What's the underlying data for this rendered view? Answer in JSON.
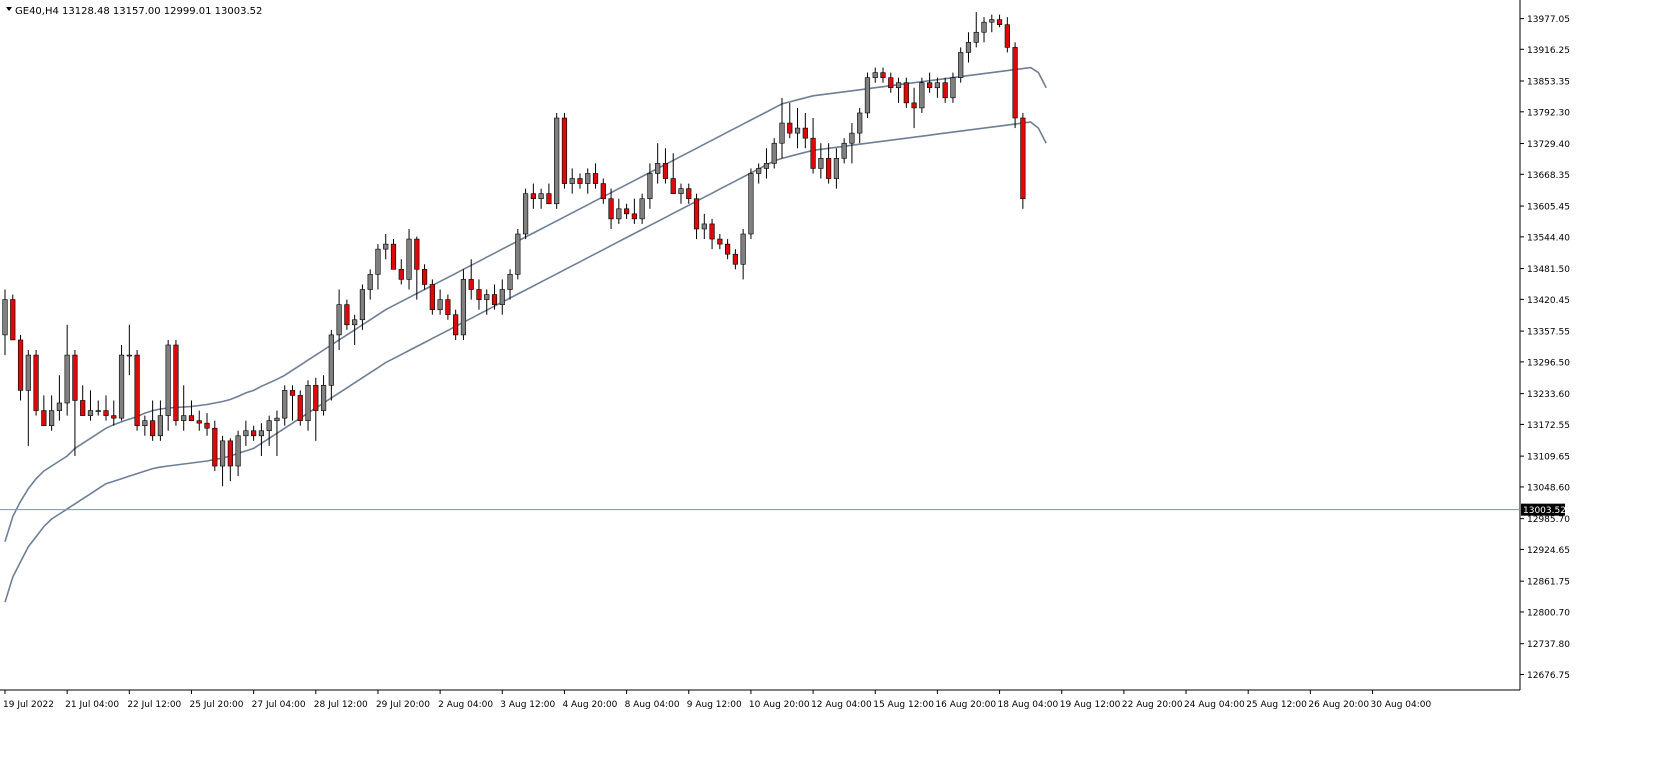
{
  "header": {
    "symbol_timeframe": "GE40,H4",
    "ohlc": "13128.48 13157.00 12999.01 13003.52"
  },
  "price_line": {
    "label": "13003.52",
    "value": 13003.52
  },
  "colors": {
    "bull": "#808080",
    "bear": "#dc0a0a",
    "wick": "#000000",
    "ma": "#6e7f96",
    "price_line": "#7f93a8",
    "price_label_bg": "#000000",
    "price_label_fg": "#ffffff",
    "axis": "#000000"
  },
  "chart_data": {
    "type": "candlestick",
    "title": "GE40,H4",
    "y_axis_position": "right",
    "ylim": [
      12646.0,
      14008.0
    ],
    "y_ticks": [
      "13977.05",
      "13916.25",
      "13853.35",
      "13792.30",
      "13729.40",
      "13668.35",
      "13605.45",
      "13544.40",
      "13481.50",
      "13420.45",
      "13357.55",
      "13296.50",
      "13233.60",
      "13172.55",
      "13109.65",
      "13048.60",
      "12985.70",
      "12924.65",
      "12861.75",
      "12800.70",
      "12737.80",
      "12676.75"
    ],
    "x_labels": [
      "19 Jul 2022",
      "21 Jul 04:00",
      "22 Jul 12:00",
      "25 Jul 20:00",
      "27 Jul 04:00",
      "28 Jul 12:00",
      "29 Jul 20:00",
      "2 Aug 04:00",
      "3 Aug 12:00",
      "4 Aug 20:00",
      "8 Aug 04:00",
      "9 Aug 12:00",
      "10 Aug 20:00",
      "12 Aug 04:00",
      "15 Aug 12:00",
      "16 Aug 20:00",
      "18 Aug 04:00",
      "19 Aug 12:00",
      "22 Aug 20:00",
      "24 Aug 04:00",
      "25 Aug 12:00",
      "26 Aug 20:00",
      "30 Aug 04:00"
    ],
    "x_label_candle_index": [
      0,
      8,
      16,
      24,
      32,
      40,
      48,
      56,
      64,
      72,
      80,
      88,
      96,
      104,
      112,
      120,
      128,
      136,
      144,
      152,
      160,
      168,
      176
    ],
    "candles": [
      {
        "o": 13350,
        "h": 13440,
        "l": 13310,
        "c": 13420
      },
      {
        "o": 13420,
        "h": 13430,
        "l": 13340,
        "c": 13340
      },
      {
        "o": 13340,
        "h": 13350,
        "l": 13220,
        "c": 13240
      },
      {
        "o": 13240,
        "h": 13320,
        "l": 13130,
        "c": 13310
      },
      {
        "o": 13310,
        "h": 13320,
        "l": 13190,
        "c": 13200
      },
      {
        "o": 13200,
        "h": 13230,
        "l": 13170,
        "c": 13170
      },
      {
        "o": 13170,
        "h": 13230,
        "l": 13160,
        "c": 13200
      },
      {
        "o": 13200,
        "h": 13270,
        "l": 13180,
        "c": 13215
      },
      {
        "o": 13215,
        "h": 13370,
        "l": 13190,
        "c": 13310
      },
      {
        "o": 13310,
        "h": 13320,
        "l": 13110,
        "c": 13220
      },
      {
        "o": 13220,
        "h": 13250,
        "l": 13190,
        "c": 13190
      },
      {
        "o": 13190,
        "h": 13240,
        "l": 13180,
        "c": 13200
      },
      {
        "o": 13200,
        "h": 13220,
        "l": 13190,
        "c": 13200
      },
      {
        "o": 13200,
        "h": 13230,
        "l": 13180,
        "c": 13190
      },
      {
        "o": 13190,
        "h": 13220,
        "l": 13170,
        "c": 13185
      },
      {
        "o": 13185,
        "h": 13330,
        "l": 13180,
        "c": 13310
      },
      {
        "o": 13310,
        "h": 13370,
        "l": 13270,
        "c": 13310
      },
      {
        "o": 13310,
        "h": 13320,
        "l": 13160,
        "c": 13170
      },
      {
        "o": 13170,
        "h": 13190,
        "l": 13150,
        "c": 13180
      },
      {
        "o": 13180,
        "h": 13220,
        "l": 13140,
        "c": 13150
      },
      {
        "o": 13150,
        "h": 13220,
        "l": 13140,
        "c": 13190
      },
      {
        "o": 13190,
        "h": 13340,
        "l": 13160,
        "c": 13330
      },
      {
        "o": 13330,
        "h": 13340,
        "l": 13170,
        "c": 13180
      },
      {
        "o": 13180,
        "h": 13250,
        "l": 13160,
        "c": 13190
      },
      {
        "o": 13190,
        "h": 13220,
        "l": 13180,
        "c": 13180
      },
      {
        "o": 13180,
        "h": 13200,
        "l": 13160,
        "c": 13175
      },
      {
        "o": 13175,
        "h": 13195,
        "l": 13150,
        "c": 13165
      },
      {
        "o": 13165,
        "h": 13180,
        "l": 13080,
        "c": 13090
      },
      {
        "o": 13090,
        "h": 13150,
        "l": 13050,
        "c": 13140
      },
      {
        "o": 13140,
        "h": 13145,
        "l": 13060,
        "c": 13090
      },
      {
        "o": 13090,
        "h": 13160,
        "l": 13070,
        "c": 13150
      },
      {
        "o": 13150,
        "h": 13180,
        "l": 13130,
        "c": 13160
      },
      {
        "o": 13160,
        "h": 13170,
        "l": 13140,
        "c": 13150
      },
      {
        "o": 13150,
        "h": 13175,
        "l": 13110,
        "c": 13160
      },
      {
        "o": 13160,
        "h": 13190,
        "l": 13130,
        "c": 13180
      },
      {
        "o": 13180,
        "h": 13200,
        "l": 13110,
        "c": 13185
      },
      {
        "o": 13185,
        "h": 13250,
        "l": 13170,
        "c": 13240
      },
      {
        "o": 13240,
        "h": 13250,
        "l": 13180,
        "c": 13230
      },
      {
        "o": 13230,
        "h": 13240,
        "l": 13170,
        "c": 13180
      },
      {
        "o": 13180,
        "h": 13260,
        "l": 13160,
        "c": 13250
      },
      {
        "o": 13250,
        "h": 13265,
        "l": 13140,
        "c": 13200
      },
      {
        "o": 13200,
        "h": 13270,
        "l": 13190,
        "c": 13250
      },
      {
        "o": 13250,
        "h": 13360,
        "l": 13220,
        "c": 13350
      },
      {
        "o": 13350,
        "h": 13440,
        "l": 13320,
        "c": 13410
      },
      {
        "o": 13410,
        "h": 13420,
        "l": 13360,
        "c": 13370
      },
      {
        "o": 13370,
        "h": 13390,
        "l": 13330,
        "c": 13380
      },
      {
        "o": 13380,
        "h": 13450,
        "l": 13360,
        "c": 13440
      },
      {
        "o": 13440,
        "h": 13480,
        "l": 13420,
        "c": 13470
      },
      {
        "o": 13470,
        "h": 13530,
        "l": 13440,
        "c": 13520
      },
      {
        "o": 13520,
        "h": 13550,
        "l": 13500,
        "c": 13530
      },
      {
        "o": 13530,
        "h": 13540,
        "l": 13480,
        "c": 13480
      },
      {
        "o": 13480,
        "h": 13500,
        "l": 13450,
        "c": 13460
      },
      {
        "o": 13460,
        "h": 13560,
        "l": 13440,
        "c": 13540
      },
      {
        "o": 13540,
        "h": 13545,
        "l": 13420,
        "c": 13480
      },
      {
        "o": 13480,
        "h": 13490,
        "l": 13440,
        "c": 13450
      },
      {
        "o": 13450,
        "h": 13460,
        "l": 13390,
        "c": 13400
      },
      {
        "o": 13400,
        "h": 13440,
        "l": 13390,
        "c": 13420
      },
      {
        "o": 13420,
        "h": 13430,
        "l": 13380,
        "c": 13390
      },
      {
        "o": 13390,
        "h": 13400,
        "l": 13340,
        "c": 13350
      },
      {
        "o": 13350,
        "h": 13480,
        "l": 13340,
        "c": 13460
      },
      {
        "o": 13460,
        "h": 13500,
        "l": 13420,
        "c": 13440
      },
      {
        "o": 13440,
        "h": 13460,
        "l": 13400,
        "c": 13420
      },
      {
        "o": 13420,
        "h": 13440,
        "l": 13390,
        "c": 13430
      },
      {
        "o": 13430,
        "h": 13450,
        "l": 13400,
        "c": 13410
      },
      {
        "o": 13410,
        "h": 13460,
        "l": 13390,
        "c": 13440
      },
      {
        "o": 13440,
        "h": 13480,
        "l": 13420,
        "c": 13470
      },
      {
        "o": 13470,
        "h": 13560,
        "l": 13460,
        "c": 13550
      },
      {
        "o": 13550,
        "h": 13640,
        "l": 13540,
        "c": 13630
      },
      {
        "o": 13630,
        "h": 13650,
        "l": 13600,
        "c": 13620
      },
      {
        "o": 13620,
        "h": 13640,
        "l": 13600,
        "c": 13630
      },
      {
        "o": 13630,
        "h": 13650,
        "l": 13610,
        "c": 13610
      },
      {
        "o": 13610,
        "h": 13790,
        "l": 13600,
        "c": 13780
      },
      {
        "o": 13780,
        "h": 13790,
        "l": 13640,
        "c": 13650
      },
      {
        "o": 13650,
        "h": 13680,
        "l": 13630,
        "c": 13660
      },
      {
        "o": 13660,
        "h": 13670,
        "l": 13640,
        "c": 13650
      },
      {
        "o": 13650,
        "h": 13680,
        "l": 13630,
        "c": 13670
      },
      {
        "o": 13670,
        "h": 13690,
        "l": 13640,
        "c": 13650
      },
      {
        "o": 13650,
        "h": 13660,
        "l": 13610,
        "c": 13620
      },
      {
        "o": 13620,
        "h": 13640,
        "l": 13560,
        "c": 13580
      },
      {
        "o": 13580,
        "h": 13620,
        "l": 13570,
        "c": 13600
      },
      {
        "o": 13600,
        "h": 13610,
        "l": 13580,
        "c": 13590
      },
      {
        "o": 13590,
        "h": 13620,
        "l": 13570,
        "c": 13580
      },
      {
        "o": 13580,
        "h": 13630,
        "l": 13570,
        "c": 13620
      },
      {
        "o": 13620,
        "h": 13690,
        "l": 13600,
        "c": 13670
      },
      {
        "o": 13670,
        "h": 13730,
        "l": 13650,
        "c": 13690
      },
      {
        "o": 13690,
        "h": 13720,
        "l": 13650,
        "c": 13660
      },
      {
        "o": 13660,
        "h": 13710,
        "l": 13630,
        "c": 13630
      },
      {
        "o": 13630,
        "h": 13650,
        "l": 13610,
        "c": 13640
      },
      {
        "o": 13640,
        "h": 13650,
        "l": 13610,
        "c": 13620
      },
      {
        "o": 13620,
        "h": 13630,
        "l": 13540,
        "c": 13560
      },
      {
        "o": 13560,
        "h": 13590,
        "l": 13540,
        "c": 13570
      },
      {
        "o": 13570,
        "h": 13580,
        "l": 13520,
        "c": 13540
      },
      {
        "o": 13540,
        "h": 13550,
        "l": 13520,
        "c": 13530
      },
      {
        "o": 13530,
        "h": 13540,
        "l": 13500,
        "c": 13510
      },
      {
        "o": 13510,
        "h": 13520,
        "l": 13480,
        "c": 13490
      },
      {
        "o": 13490,
        "h": 13560,
        "l": 13460,
        "c": 13550
      },
      {
        "o": 13550,
        "h": 13680,
        "l": 13540,
        "c": 13670
      },
      {
        "o": 13670,
        "h": 13690,
        "l": 13650,
        "c": 13680
      },
      {
        "o": 13680,
        "h": 13720,
        "l": 13660,
        "c": 13690
      },
      {
        "o": 13690,
        "h": 13740,
        "l": 13680,
        "c": 13730
      },
      {
        "o": 13730,
        "h": 13820,
        "l": 13700,
        "c": 13770
      },
      {
        "o": 13770,
        "h": 13810,
        "l": 13740,
        "c": 13750
      },
      {
        "o": 13750,
        "h": 13800,
        "l": 13720,
        "c": 13760
      },
      {
        "o": 13760,
        "h": 13790,
        "l": 13720,
        "c": 13740
      },
      {
        "o": 13740,
        "h": 13780,
        "l": 13670,
        "c": 13680
      },
      {
        "o": 13680,
        "h": 13730,
        "l": 13660,
        "c": 13700
      },
      {
        "o": 13700,
        "h": 13730,
        "l": 13650,
        "c": 13660
      },
      {
        "o": 13660,
        "h": 13720,
        "l": 13640,
        "c": 13700
      },
      {
        "o": 13700,
        "h": 13740,
        "l": 13690,
        "c": 13730
      },
      {
        "o": 13730,
        "h": 13770,
        "l": 13690,
        "c": 13750
      },
      {
        "o": 13750,
        "h": 13800,
        "l": 13730,
        "c": 13790
      },
      {
        "o": 13790,
        "h": 13870,
        "l": 13780,
        "c": 13860
      },
      {
        "o": 13860,
        "h": 13880,
        "l": 13850,
        "c": 13870
      },
      {
        "o": 13870,
        "h": 13880,
        "l": 13850,
        "c": 13860
      },
      {
        "o": 13860,
        "h": 13870,
        "l": 13830,
        "c": 13840
      },
      {
        "o": 13840,
        "h": 13860,
        "l": 13810,
        "c": 13850
      },
      {
        "o": 13850,
        "h": 13860,
        "l": 13800,
        "c": 13810
      },
      {
        "o": 13810,
        "h": 13840,
        "l": 13760,
        "c": 13800
      },
      {
        "o": 13800,
        "h": 13860,
        "l": 13790,
        "c": 13850
      },
      {
        "o": 13850,
        "h": 13870,
        "l": 13830,
        "c": 13840
      },
      {
        "o": 13840,
        "h": 13860,
        "l": 13820,
        "c": 13850
      },
      {
        "o": 13850,
        "h": 13860,
        "l": 13810,
        "c": 13820
      },
      {
        "o": 13820,
        "h": 13870,
        "l": 13810,
        "c": 13860
      },
      {
        "o": 13860,
        "h": 13920,
        "l": 13850,
        "c": 13910
      },
      {
        "o": 13910,
        "h": 13950,
        "l": 13890,
        "c": 13930
      },
      {
        "o": 13930,
        "h": 13990,
        "l": 13920,
        "c": 13950
      },
      {
        "o": 13950,
        "h": 13980,
        "l": 13930,
        "c": 13970
      },
      {
        "o": 13970,
        "h": 13985,
        "l": 13950,
        "c": 13975
      },
      {
        "o": 13975,
        "h": 13985,
        "l": 13960,
        "c": 13965
      },
      {
        "o": 13965,
        "h": 13980,
        "l": 13910,
        "c": 13920
      },
      {
        "o": 13920,
        "h": 13930,
        "l": 13760,
        "c": 13780
      },
      {
        "o": 13780,
        "h": 13790,
        "l": 13600,
        "c": 13620
      }
    ],
    "series": [
      {
        "values": [
          12940,
          12990,
          13020,
          13045,
          13065,
          13080,
          13090,
          13100,
          13110,
          13125,
          13135,
          13145,
          13155,
          13165,
          13172,
          13178,
          13183,
          13188,
          13195,
          13200,
          13203,
          13205,
          13206,
          13207,
          13208,
          13210,
          13212,
          13215,
          13218,
          13222,
          13228,
          13235,
          13240,
          13248,
          13255,
          13262,
          13270,
          13280,
          13290,
          13300,
          13310,
          13320,
          13330,
          13340,
          13350,
          13360,
          13370,
          13380,
          13390,
          13400,
          13408,
          13416,
          13424,
          13432,
          13440,
          13448,
          13456,
          13464,
          13472,
          13480,
          13488,
          13496,
          13504,
          13512,
          13520,
          13528,
          13536,
          13544,
          13552,
          13560,
          13568,
          13576,
          13584,
          13592,
          13600,
          13608,
          13616,
          13624,
          13632,
          13640,
          13648,
          13656,
          13664,
          13672,
          13680,
          13688,
          13696,
          13704,
          13712,
          13720,
          13728,
          13736,
          13744,
          13752,
          13760,
          13768,
          13776,
          13784,
          13792,
          13800,
          13808,
          13812,
          13816,
          13820,
          13824,
          13826,
          13828,
          13830,
          13832,
          13834,
          13836,
          13838,
          13840,
          13842,
          13844,
          13846,
          13848,
          13850,
          13852,
          13854,
          13856,
          13858,
          13860,
          13862,
          13864,
          13866,
          13868,
          13870,
          13872,
          13874,
          13876,
          13878,
          13880,
          13870,
          13840
        ]
      },
      {
        "values": [
          12820,
          12870,
          12900,
          12930,
          12950,
          12970,
          12985,
          12995,
          13005,
          13015,
          13025,
          13035,
          13045,
          13055,
          13060,
          13065,
          13070,
          13075,
          13080,
          13085,
          13088,
          13090,
          13092,
          13094,
          13096,
          13098,
          13100,
          13103,
          13106,
          13110,
          13115,
          13120,
          13125,
          13135,
          13145,
          13155,
          13165,
          13175,
          13185,
          13195,
          13205,
          13215,
          13225,
          13235,
          13245,
          13255,
          13265,
          13275,
          13285,
          13295,
          13303,
          13311,
          13319,
          13327,
          13335,
          13343,
          13351,
          13359,
          13367,
          13375,
          13383,
          13391,
          13399,
          13407,
          13415,
          13423,
          13431,
          13439,
          13447,
          13455,
          13463,
          13471,
          13479,
          13487,
          13495,
          13503,
          13511,
          13519,
          13527,
          13535,
          13543,
          13551,
          13559,
          13567,
          13575,
          13583,
          13591,
          13599,
          13607,
          13615,
          13623,
          13631,
          13639,
          13647,
          13655,
          13663,
          13671,
          13679,
          13687,
          13695,
          13700,
          13704,
          13708,
          13712,
          13716,
          13718,
          13720,
          13722,
          13724,
          13726,
          13728,
          13730,
          13732,
          13734,
          13736,
          13738,
          13740,
          13742,
          13744,
          13746,
          13748,
          13750,
          13752,
          13754,
          13756,
          13758,
          13760,
          13762,
          13764,
          13766,
          13768,
          13770,
          13772,
          13760,
          13730
        ]
      }
    ]
  }
}
